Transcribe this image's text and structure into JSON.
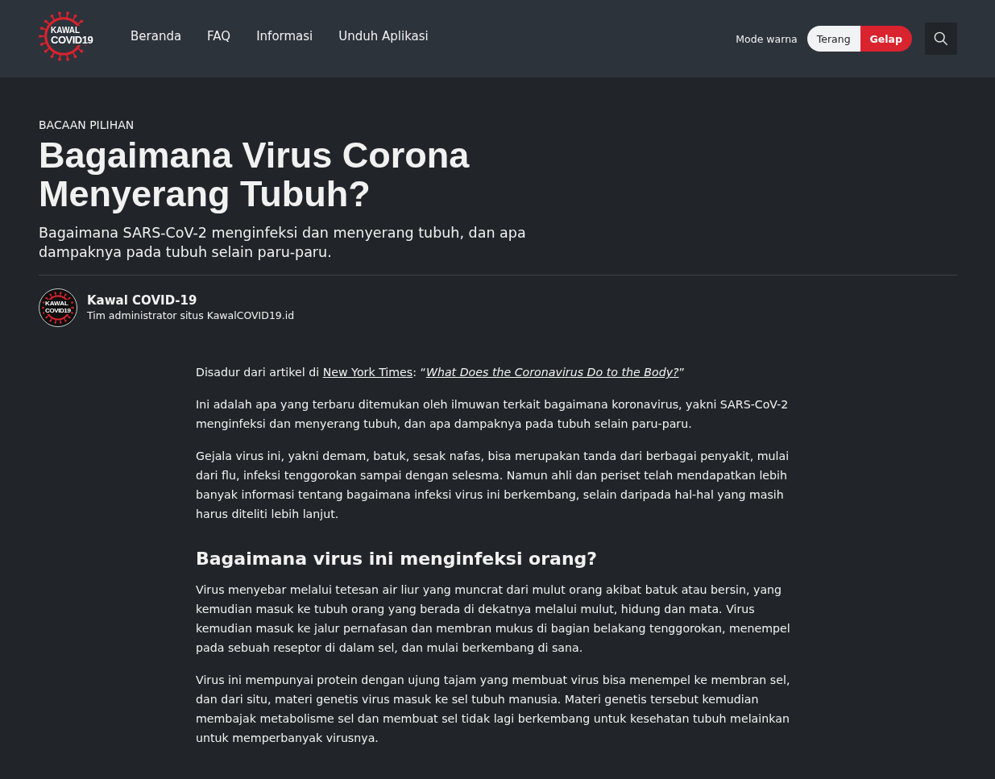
{
  "header": {
    "logo": {
      "line_1": "KAWAL",
      "line_2": "COVID19"
    },
    "nav": [
      {
        "label": "Beranda"
      },
      {
        "label": "FAQ"
      },
      {
        "label": "Informasi"
      },
      {
        "label": "Unduh Aplikasi"
      }
    ],
    "color_mode": {
      "label": "Mode warna",
      "options": [
        {
          "label": "Terang",
          "selected": false
        },
        {
          "label": "Gelap",
          "selected": true
        }
      ]
    }
  },
  "article": {
    "eyebrow": "BACAAN PILIHAN",
    "title": "Bagaimana Virus Corona Menyerang Tubuh?",
    "subtitle": "Bagaimana SARS-CoV-2 menginfeksi dan menyerang tubuh, dan apa dampaknya pada tubuh selain paru-paru.",
    "author": {
      "avatar": {
        "line_1": "KAWAL",
        "line_2": "COVID19"
      },
      "name": "Kawal COVID-19",
      "bio": "Tim administrator situs KawalCOVID19.id"
    },
    "body": [
      {
        "kind": "paragraph",
        "parts": [
          {
            "kind": "text",
            "text": "Disadur dari artikel di "
          },
          {
            "kind": "link",
            "text": "New York Times"
          },
          {
            "kind": "text",
            "text": ": “"
          },
          {
            "kind": "link",
            "italic": true,
            "text": "What Does the Coronavirus Do to the Body?"
          },
          {
            "kind": "text",
            "text": "”"
          }
        ]
      },
      {
        "kind": "paragraph",
        "text": "Ini adalah apa yang terbaru ditemukan oleh ilmuwan terkait bagaimana koronavirus, yakni SARS-CoV-2 menginfeksi dan menyerang tubuh, dan apa dampaknya pada tubuh selain paru-paru."
      },
      {
        "kind": "paragraph",
        "text": "Gejala virus ini, yakni demam, batuk, sesak nafas, bisa merupakan tanda dari berbagai penyakit, mulai dari flu, infeksi tenggorokan sampai dengan selesma. Namun ahli dan periset telah mendapatkan lebih banyak informasi tentang bagaimana infeksi virus ini berkembang, selain daripada hal-hal yang masih harus diteliti lebih lanjut."
      },
      {
        "kind": "heading",
        "text": "Bagaimana virus ini menginfeksi orang?"
      },
      {
        "kind": "paragraph",
        "text": "Virus menyebar melalui tetesan air liur yang muncrat dari mulut orang akibat batuk atau bersin, yang kemudian masuk ke tubuh orang yang berada di dekatnya melalui mulut, hidung dan mata.  Virus kemudian masuk ke jalur pernafasan dan membran mukus di bagian belakang tenggorokan, menempel pada sebuah reseptor di dalam sel, dan mulai berkembang di sana."
      },
      {
        "kind": "paragraph",
        "text": "Virus ini mempunyai protein dengan ujung tajam yang membuat virus bisa menempel ke membran sel, dan dari situ, materi genetis virus masuk ke sel tubuh manusia. Materi genetis tersebut kemudian membajak metabolisme sel dan membuat sel tidak lagi berkembang untuk kesehatan tubuh melainkan untuk memperbanyak virusnya."
      }
    ]
  }
}
